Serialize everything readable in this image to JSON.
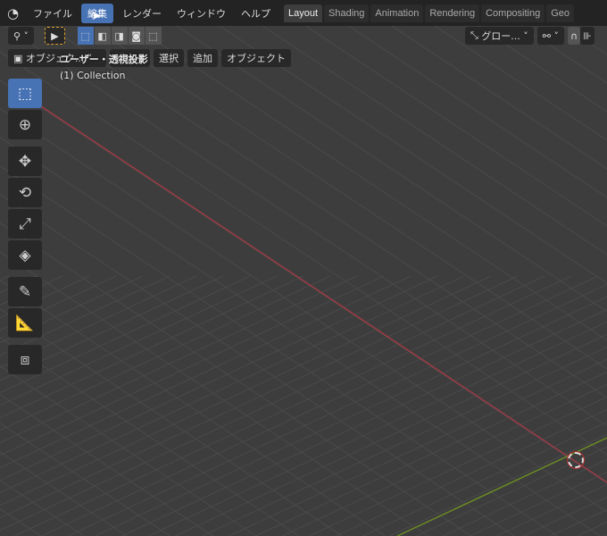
{
  "topbar": {
    "menus": [
      "ファイル",
      "編集",
      "レンダー",
      "ウィンドウ",
      "ヘルプ"
    ],
    "active_menu": "編集",
    "tabs": [
      "Layout",
      "Shading",
      "Animation",
      "Rendering",
      "Compositing",
      "Geo"
    ],
    "active_tab": "Layout"
  },
  "header": {
    "transform_orientation": "グロー...",
    "mode": "オブジェク...",
    "menus": [
      "ビュー",
      "選択",
      "追加",
      "オブジェクト"
    ]
  },
  "overlay": {
    "view_name": "ユーザー・透視投影",
    "collection": "(1) Collection"
  },
  "tools": [
    "select-box",
    "cursor",
    "move",
    "rotate",
    "scale",
    "transform",
    "annotate",
    "measure",
    "add-cube"
  ],
  "colors": {
    "accent": "#4772b3",
    "x_axis": "#9b3a45",
    "y_axis": "#6b8a25",
    "background": "#3d3d3d"
  }
}
